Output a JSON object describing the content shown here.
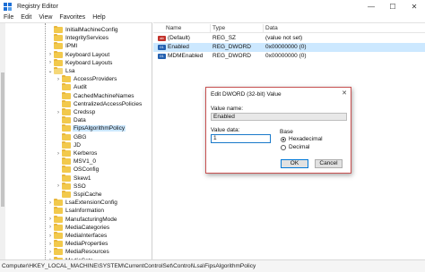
{
  "window": {
    "title": "Registry Editor",
    "controls": [
      "—",
      "☐",
      "✕"
    ]
  },
  "menu": [
    "File",
    "Edit",
    "View",
    "Favorites",
    "Help"
  ],
  "tree": {
    "items": [
      {
        "label": "InitialMachineConfig",
        "expander": ""
      },
      {
        "label": "IntegrityServices",
        "expander": ""
      },
      {
        "label": "IPMI",
        "expander": ""
      },
      {
        "label": "Keyboard Layout",
        "expander": "›"
      },
      {
        "label": "Keyboard Layouts",
        "expander": "›"
      },
      {
        "label": "Lsa",
        "expander": "⌄"
      },
      {
        "label": "AccessProviders",
        "expander": "›"
      },
      {
        "label": "Audit",
        "expander": ""
      },
      {
        "label": "CachedMachineNames",
        "expander": ""
      },
      {
        "label": "CentralizedAccessPolicies",
        "expander": ""
      },
      {
        "label": "Credssp",
        "expander": "›"
      },
      {
        "label": "Data",
        "expander": ""
      },
      {
        "label": "FipsAlgorithmPolicy",
        "expander": ""
      },
      {
        "label": "GBG",
        "expander": ""
      },
      {
        "label": "JD",
        "expander": ""
      },
      {
        "label": "Kerberos",
        "expander": "›"
      },
      {
        "label": "MSV1_0",
        "expander": ""
      },
      {
        "label": "OSConfig",
        "expander": ""
      },
      {
        "label": "Skew1",
        "expander": ""
      },
      {
        "label": "SSO",
        "expander": "›"
      },
      {
        "label": "SspiCache",
        "expander": ""
      },
      {
        "label": "LsaExtensionConfig",
        "expander": "›"
      },
      {
        "label": "LsaInformation",
        "expander": ""
      },
      {
        "label": "ManufacturingMode",
        "expander": "›"
      },
      {
        "label": "MediaCategories",
        "expander": "›"
      },
      {
        "label": "MediaInterfaces",
        "expander": "›"
      },
      {
        "label": "MediaProperties",
        "expander": "›"
      },
      {
        "label": "MediaResources",
        "expander": "›"
      },
      {
        "label": "MediaSets",
        "expander": "›"
      }
    ]
  },
  "list": {
    "columns": [
      "Name",
      "Type",
      "Data"
    ],
    "rows": [
      {
        "icon": "ab",
        "name": "(Default)",
        "type": "REG_SZ",
        "data": "(value not set)"
      },
      {
        "icon": "bin",
        "name": "Enabled",
        "type": "REG_DWORD",
        "data": "0x00000000 (0)"
      },
      {
        "icon": "bin",
        "name": "MDMEnabled",
        "type": "REG_DWORD",
        "data": "0x00000000 (0)"
      }
    ]
  },
  "dialog": {
    "title": "Edit DWORD (32-bit) Value",
    "close": "✕",
    "value_name_label": "Value name:",
    "value_name": "Enabled",
    "value_data_label": "Value data:",
    "value_data": "1",
    "base_label": "Base",
    "hex_label": "Hexadecimal",
    "dec_label": "Decimal",
    "ok_label": "OK",
    "cancel_label": "Cancel"
  },
  "status": {
    "path": "Computer\\HKEY_LOCAL_MACHINE\\SYSTEM\\CurrentControlSet\\Control\\Lsa\\FipsAlgorithmPolicy"
  }
}
